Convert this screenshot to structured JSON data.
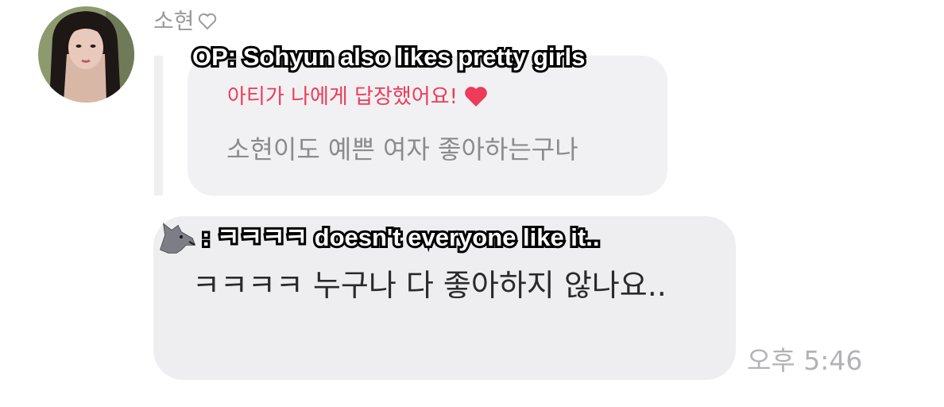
{
  "sender": {
    "name": "소현",
    "heart_icon": "heart-outline-icon"
  },
  "reply_card": {
    "title": "아티가 나에게 답장했어요!",
    "title_color": "#ee3b5a",
    "quoted_text": "소현이도 예쁜 여자 좋아하는구나"
  },
  "message": {
    "text": "ㅋㅋㅋㅋ 누구나 다 좋아하지 않나요..",
    "time": "오후 5:46"
  },
  "captions": {
    "op": "OP: Sohyun also likes pretty girls",
    "reply_icon": "wolf-icon",
    "reply": ": ㅋㅋㅋㅋ doesn't everyone like it.."
  }
}
